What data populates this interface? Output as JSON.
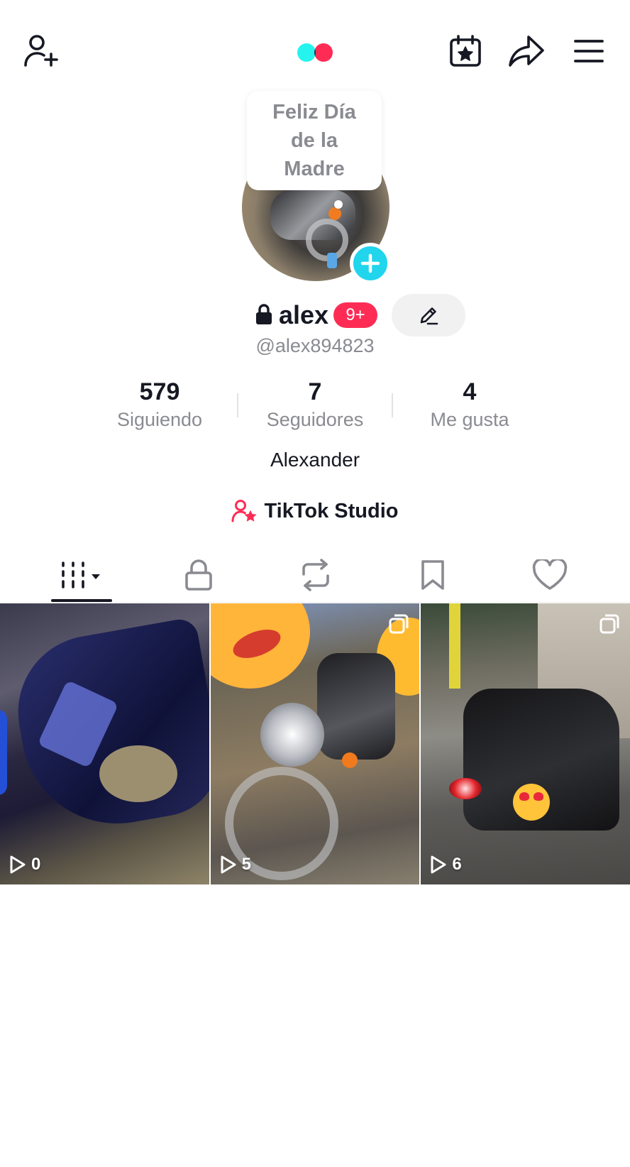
{
  "header": {
    "add_friend_icon": "person-add-icon",
    "logo": "tiktok-dots",
    "calendar_icon": "calendar-star-icon",
    "share_icon": "share-arrow-icon",
    "menu_icon": "hamburger-menu-icon"
  },
  "note": {
    "text": "Feliz Día de la Madre"
  },
  "profile": {
    "username": "alex",
    "notification_badge": "9+",
    "handle": "@alex894823",
    "bio": "Alexander",
    "studio_label": "TikTok Studio"
  },
  "stats": [
    {
      "value": "579",
      "label": "Siguiendo"
    },
    {
      "value": "7",
      "label": "Seguidores"
    },
    {
      "value": "4",
      "label": "Me gusta"
    }
  ],
  "tabs": [
    {
      "icon": "videos-grid-icon",
      "active": true
    },
    {
      "icon": "lock-icon",
      "active": false
    },
    {
      "icon": "repost-icon",
      "active": false
    },
    {
      "icon": "bookmark-icon",
      "active": false
    },
    {
      "icon": "heart-icon",
      "active": false
    }
  ],
  "videos": [
    {
      "views": "0",
      "multi": false
    },
    {
      "views": "5",
      "multi": true
    },
    {
      "views": "6",
      "multi": true
    }
  ],
  "colors": {
    "accent_red": "#fe2c55",
    "accent_cyan": "#25f4ee",
    "add_badge": "#20d5ec",
    "text_primary": "#161823",
    "text_secondary": "#8a8b91"
  }
}
